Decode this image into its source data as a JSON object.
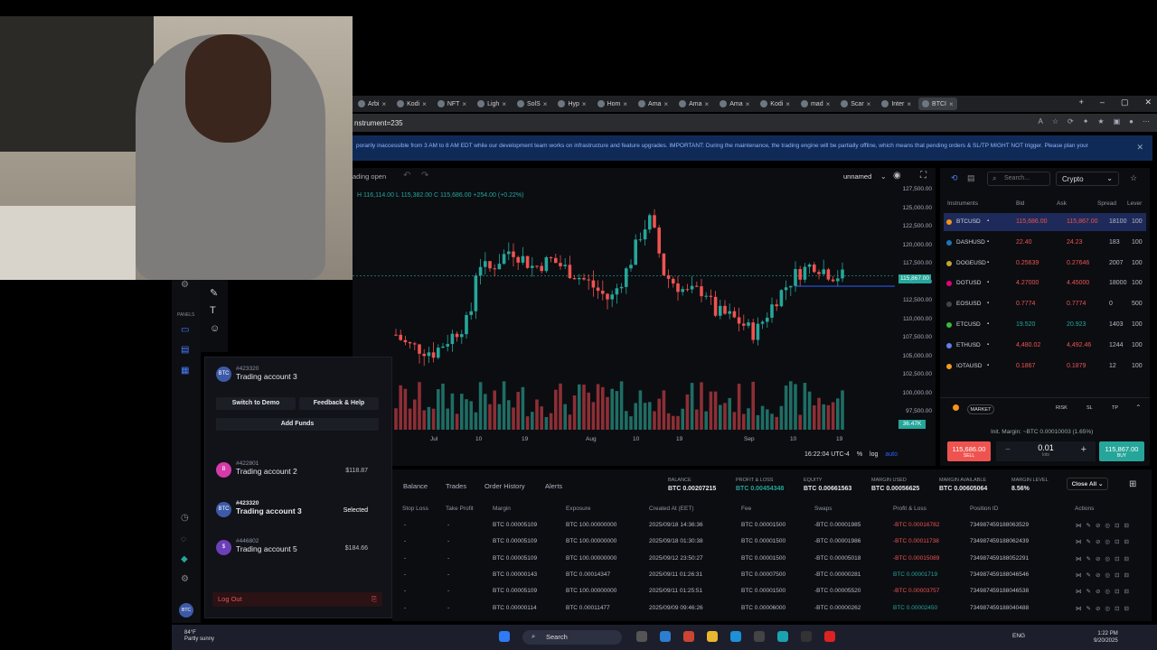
{
  "browser": {
    "tabs": [
      "Arbi",
      "Kodi",
      "NFT",
      "Ligh",
      "SolS",
      "Hyp",
      "Hom",
      "Ama",
      "Ama",
      "Ama",
      "Kodi",
      "mad",
      "Scar",
      "Inter",
      "BTCI"
    ],
    "address": "nstrument=235"
  },
  "banner": {
    "text": "porarily inaccessible from 3 AM to 8 AM EDT while our development team works on infrastructure and feature upgrades. IMPORTANT: During the maintenance, the trading engine will be partially offline, which means that pending orders & SL/TP MIGHT NOT trigger. Please plan your"
  },
  "chart": {
    "mode": "ading open",
    "layout": "unnamed",
    "ohlc": "H 116,114.00 L 115,382.00 C 115,686.00 +254.00 (+0.22%)",
    "last_price_badge": "115,867.00",
    "low_badge": "36.47K",
    "time": "16:22:04 UTC-4",
    "pct": "%",
    "log": "log",
    "auto": "auto"
  },
  "chart_data": {
    "type": "candlestick",
    "symbol": "BTCUSD",
    "y_ticks": [
      "127,500.00",
      "125,000.00",
      "122,500.00",
      "120,000.00",
      "117,500.00",
      "115,000.00",
      "112,500.00",
      "110,000.00",
      "107,500.00",
      "105,000.00",
      "102,500.00",
      "100,000.00",
      "97,500.00"
    ],
    "x_ticks": [
      "Jul",
      "10",
      "19",
      "Aug",
      "10",
      "19",
      "Sep",
      "10",
      "19"
    ],
    "ylim": [
      95000,
      128000
    ],
    "last_price": 115867
  },
  "account_panel": {
    "current": {
      "num": "#423320",
      "name": "Trading account 3",
      "avatar": "BTC"
    },
    "switch_demo": "Switch to Demo",
    "feedback": "Feedback & Help",
    "add_funds": "Add Funds",
    "accounts": [
      {
        "num": "#422801",
        "name": "Trading account 2",
        "right": "$118.87",
        "avatar": "B",
        "color": "#d63aa8"
      },
      {
        "num": "#423320",
        "name": "Trading account 3",
        "right": "Selected",
        "avatar": "BTC",
        "color": "#3d5aa8"
      },
      {
        "num": "#446802",
        "name": "Trading account 5",
        "right": "$184.66",
        "avatar": "$",
        "color": "#6b3fb8"
      }
    ],
    "logout": "Log Out"
  },
  "left_nav": {
    "panels": "PANELS"
  },
  "instruments": {
    "search_placeholder": "Search...",
    "category": "Crypto",
    "headers": {
      "instrument": "Instruments",
      "bid": "Bid",
      "ask": "Ask",
      "spread": "Spread",
      "leverage": "Lever"
    },
    "rows": [
      {
        "sym": "BTCUSD",
        "bid": "115,686.00",
        "ask": "115,867.00",
        "spread": "18100",
        "lev": "100",
        "color": "#f7931a"
      },
      {
        "sym": "DASHUSD",
        "bid": "22.40",
        "ask": "24.23",
        "spread": "183",
        "lev": "100",
        "color": "#1c75bc"
      },
      {
        "sym": "DOGEUSD",
        "bid": "0.25639",
        "ask": "0.27646",
        "spread": "2007",
        "lev": "100",
        "color": "#c2a633"
      },
      {
        "sym": "DOTUSD",
        "bid": "4.27000",
        "ask": "4.45000",
        "spread": "18000",
        "lev": "100",
        "color": "#e6007a"
      },
      {
        "sym": "EOSUSD",
        "bid": "0.7774",
        "ask": "0.7774",
        "spread": "0",
        "lev": "500",
        "color": "#444"
      },
      {
        "sym": "ETCUSD",
        "bid": "19.520",
        "ask": "20.923",
        "spread": "1403",
        "lev": "100",
        "color": "#3ab83a"
      },
      {
        "sym": "ETHUSD",
        "bid": "4,480.02",
        "ask": "4,492.46",
        "spread": "1244",
        "lev": "100",
        "color": "#627eea"
      },
      {
        "sym": "IOTAUSD",
        "bid": "0.1867",
        "ask": "0.1879",
        "spread": "12",
        "lev": "100",
        "color": "#f49b20"
      }
    ]
  },
  "order": {
    "market": "MARKET",
    "tabs": [
      "RISK",
      "SL",
      "TP"
    ],
    "margin": "Init. Margin: ~BTC 0.00010003 (1.65%)",
    "sell_price": "115,686.00",
    "sell_label": "SELL",
    "buy_price": "115,867.00",
    "buy_label": "BUY",
    "lots": "0.01",
    "lots_label": "lots"
  },
  "bottom": {
    "tabs": [
      "Balance",
      "Trades",
      "Order History",
      "Alerts"
    ],
    "stats": [
      {
        "label": "BALANCE",
        "value": "BTC 0.00207215"
      },
      {
        "label": "PROFIT & LOSS",
        "value": "BTC 0.00454348"
      },
      {
        "label": "EQUITY",
        "value": "BTC 0.00661563"
      },
      {
        "label": "MARGIN USED",
        "value": "BTC 0.00056625"
      },
      {
        "label": "MARGIN AVAILABLE",
        "value": "BTC 0.00605064"
      },
      {
        "label": "MARGIN LEVEL",
        "value": "8.56%"
      }
    ],
    "close_all": "Close All",
    "headers": [
      "Stop Loss",
      "Take Profit",
      "Margin",
      "Exposure",
      "Created At (EET)",
      "Fee",
      "Swaps",
      "Profit & Loss",
      "Position ID",
      "Actions"
    ],
    "rows": [
      {
        "sl": "-",
        "tp": "-",
        "margin": "BTC 0.00005109",
        "exp": "BTC 100.00000000",
        "created": "2025/09/18 14:36:36",
        "fee": "BTC 0.00001500",
        "swaps": "-BTC 0.00001985",
        "pl": "-BTC 0.00016782",
        "pos": "734987459188063529",
        "neg": true
      },
      {
        "sl": "-",
        "tp": "-",
        "margin": "BTC 0.00005109",
        "exp": "BTC 100.00000000",
        "created": "2025/09/18 01:30:38",
        "fee": "BTC 0.00001500",
        "swaps": "-BTC 0.00001986",
        "pl": "-BTC 0.00011738",
        "pos": "734987459188062439",
        "neg": true
      },
      {
        "sl": "-",
        "tp": "-",
        "margin": "BTC 0.00005109",
        "exp": "BTC 100.00000000",
        "created": "2025/09/12 23:50:27",
        "fee": "BTC 0.00001500",
        "swaps": "-BTC 0.00005018",
        "pl": "-BTC 0.00015089",
        "pos": "734987459188052291",
        "neg": true
      },
      {
        "sl": "-",
        "tp": "-",
        "margin": "BTC 0.00000143",
        "exp": "BTC 0.00014347",
        "created": "2025/09/11 01:26:31",
        "fee": "BTC 0.00007500",
        "swaps": "-BTC 0.00000281",
        "pl": "BTC 0.00001719",
        "pos": "734987459188046546",
        "neg": false
      },
      {
        "sl": "-",
        "tp": "-",
        "margin": "BTC 0.00005109",
        "exp": "BTC 100.00000000",
        "created": "2025/09/11 01:25:51",
        "fee": "BTC 0.00001500",
        "swaps": "-BTC 0.00005520",
        "pl": "-BTC 0.00003757",
        "pos": "734987459188046538",
        "neg": true
      },
      {
        "sl": "-",
        "tp": "-",
        "margin": "BTC 0.00000114",
        "exp": "BTC 0.00011477",
        "created": "2025/09/09 09:46:26",
        "fee": "BTC 0.00006000",
        "swaps": "-BTC 0.00000262",
        "pl": "BTC 0.00002450",
        "pos": "734987459188040488",
        "neg": false
      }
    ]
  },
  "taskbar": {
    "temp": "84°F",
    "weather": "Partly sunny",
    "search": "Search",
    "lang": "ENG",
    "time": "1:22 PM",
    "date": "9/20/2025"
  }
}
